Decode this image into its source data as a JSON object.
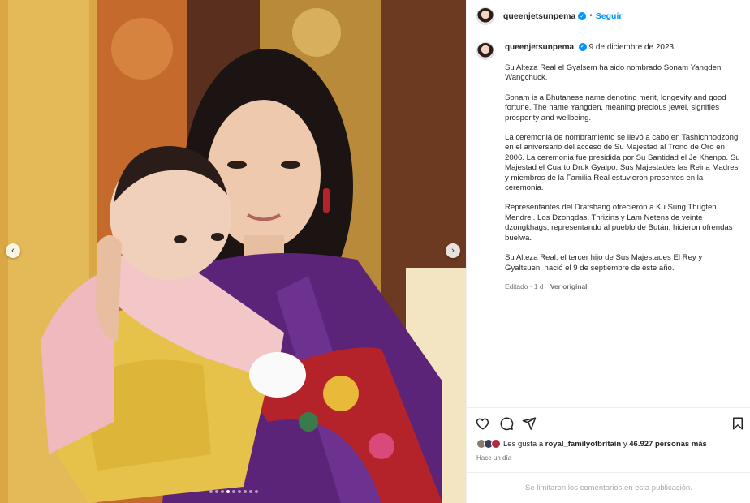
{
  "post": {
    "username": "queenjetsunpema",
    "separator": "•",
    "follow_label": "Seguir",
    "verified_symbol": "✓",
    "caption_date": "9 de diciembre de 2023:",
    "paragraphs": [
      "Su Alteza Real el Gyalsem ha sido nombrado Sonam Yangden Wangchuck.",
      "Sonam is a Bhutanese name denoting merit, longevity and good fortune. The name Yangden, meaning precious jewel, signifies prosperity and wellbeing.",
      "La ceremonia de nombramiento se llevó a cabo en Tashichhodzong en el aniversario del acceso de Su Majestad al Trono de Oro en 2006. La ceremonia fue presidida por Su Santidad el Je Khenpo. Su Majestad el Cuarto Druk Gyalpo, Sus Majestades las Reina Madres y miembros de la Familia Real estuvieron presentes en la ceremonia.",
      "Representantes del Dratshang ofrecieron a Ku Sung Thugten Mendrel. Los Dzongdas, Thrizins y Lam Netens de veinte dzongkhags, representando al pueblo de Bután, hicieron ofrendas buelwa.",
      "Su Alteza Real, el tercer hijo de Sus Majestades El Rey y Gyaltsuen, nació el 9 de septiembre de este año."
    ],
    "edited_label": "Editado · 1 d",
    "view_original_label": "Ver original",
    "likes_prefix": "Les gusta a",
    "likes_user": "royal_familyofbritain",
    "likes_connector": "y",
    "likes_count": "46.927 personas más",
    "time_ago": "Hace un día",
    "comments_disabled": "Se limitaron los comentarios en esta publicación."
  },
  "carousel": {
    "prev_glyph": "‹",
    "next_glyph": "›",
    "slide_count": 9,
    "active_slide": 3
  },
  "icons": [
    "heart-icon",
    "comment-icon",
    "share-icon",
    "bookmark-icon",
    "verified-icon"
  ],
  "colors": {
    "accent": "#0095f6",
    "text": "#262626",
    "muted": "#737373",
    "border": "#efefef"
  }
}
